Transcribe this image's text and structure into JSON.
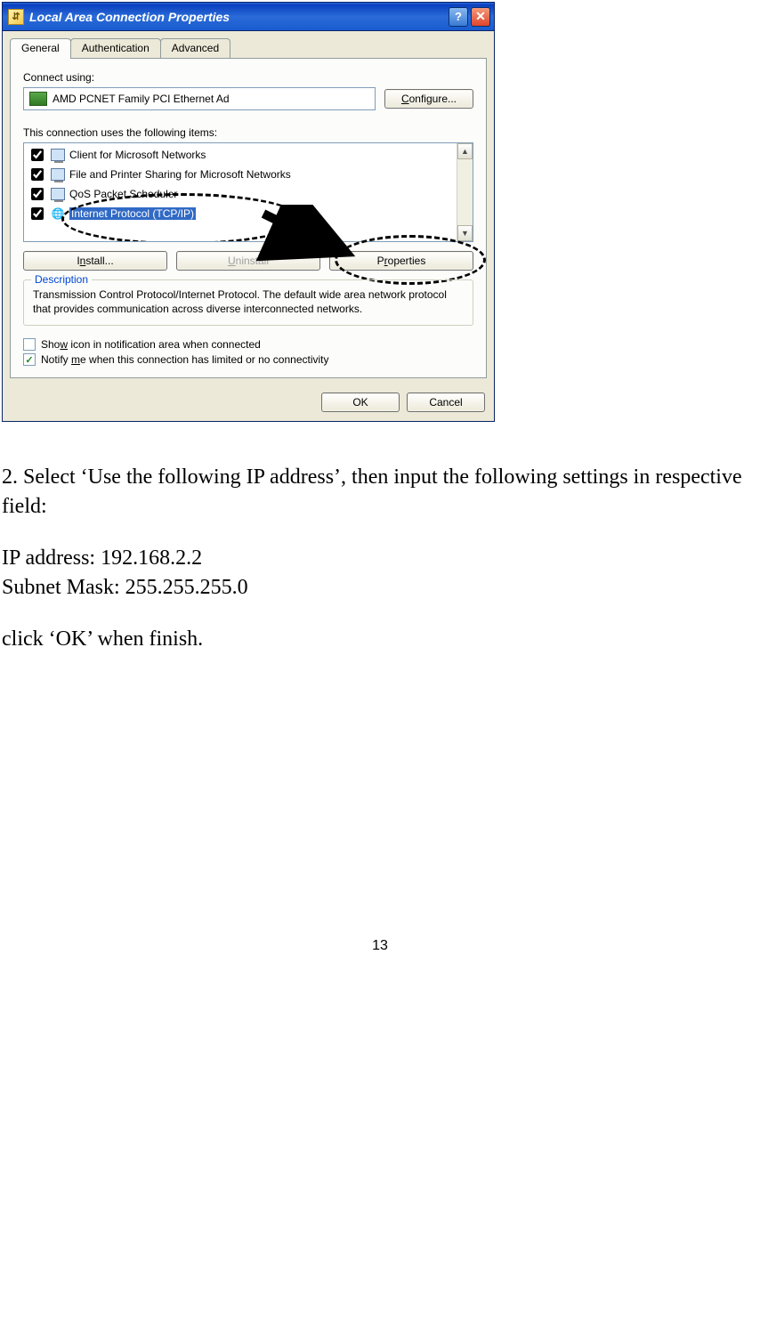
{
  "dialog": {
    "title": "Local Area Connection Properties",
    "tabs": [
      "General",
      "Authentication",
      "Advanced"
    ],
    "connect_using_label": "Connect using:",
    "adapter_name": "AMD PCNET Family PCI Ethernet Ad",
    "configure_button": "Configure...",
    "items_label": "This connection uses the following items:",
    "components": [
      "Client for Microsoft Networks",
      "File and Printer Sharing for Microsoft Networks",
      "QoS Packet Scheduler",
      "Internet Protocol (TCP/IP)"
    ],
    "install_button": "Install...",
    "uninstall_button": "Uninstall",
    "properties_button": "Properties",
    "description_label": "Description",
    "description_text": "Transmission Control Protocol/Internet Protocol. The default wide area network protocol that provides communication across diverse interconnected networks.",
    "show_icon_label": "Show icon in notification area when connected",
    "notify_label": "Notify me when this connection has limited or no connectivity",
    "ok_button": "OK",
    "cancel_button": "Cancel"
  },
  "instructions": {
    "step2": "2. Select ‘Use the following IP address’, then input the following settings in respective field:",
    "ip_line": "IP address: 192.168.2.2",
    "subnet_line": "Subnet Mask: 255.255.255.0",
    "finish_line": "click ‘OK’ when finish.",
    "page_number": "13"
  }
}
